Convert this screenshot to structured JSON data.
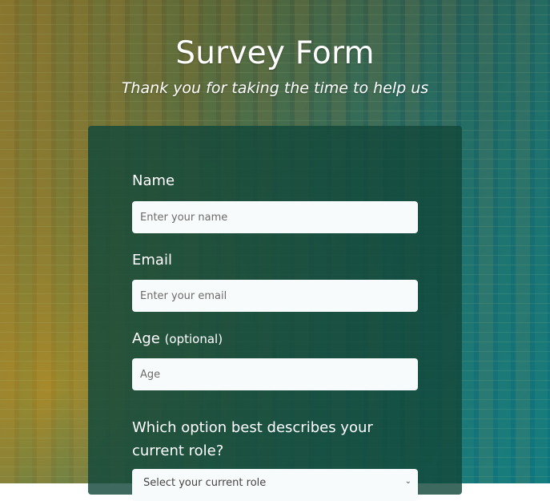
{
  "header": {
    "title": "Survey Form",
    "subtitle": "Thank you for taking the time to help us"
  },
  "form": {
    "name": {
      "label": "Name",
      "placeholder": "Enter your name",
      "value": ""
    },
    "email": {
      "label": "Email",
      "placeholder": "Enter your email",
      "value": ""
    },
    "age": {
      "label": "Age",
      "optional": "(optional)",
      "placeholder": "Age",
      "value": ""
    },
    "role": {
      "question": "Which option best describes your current role?",
      "selected": "Select your current role"
    }
  },
  "icons": {
    "select_chevron": "chevron-down-icon"
  }
}
